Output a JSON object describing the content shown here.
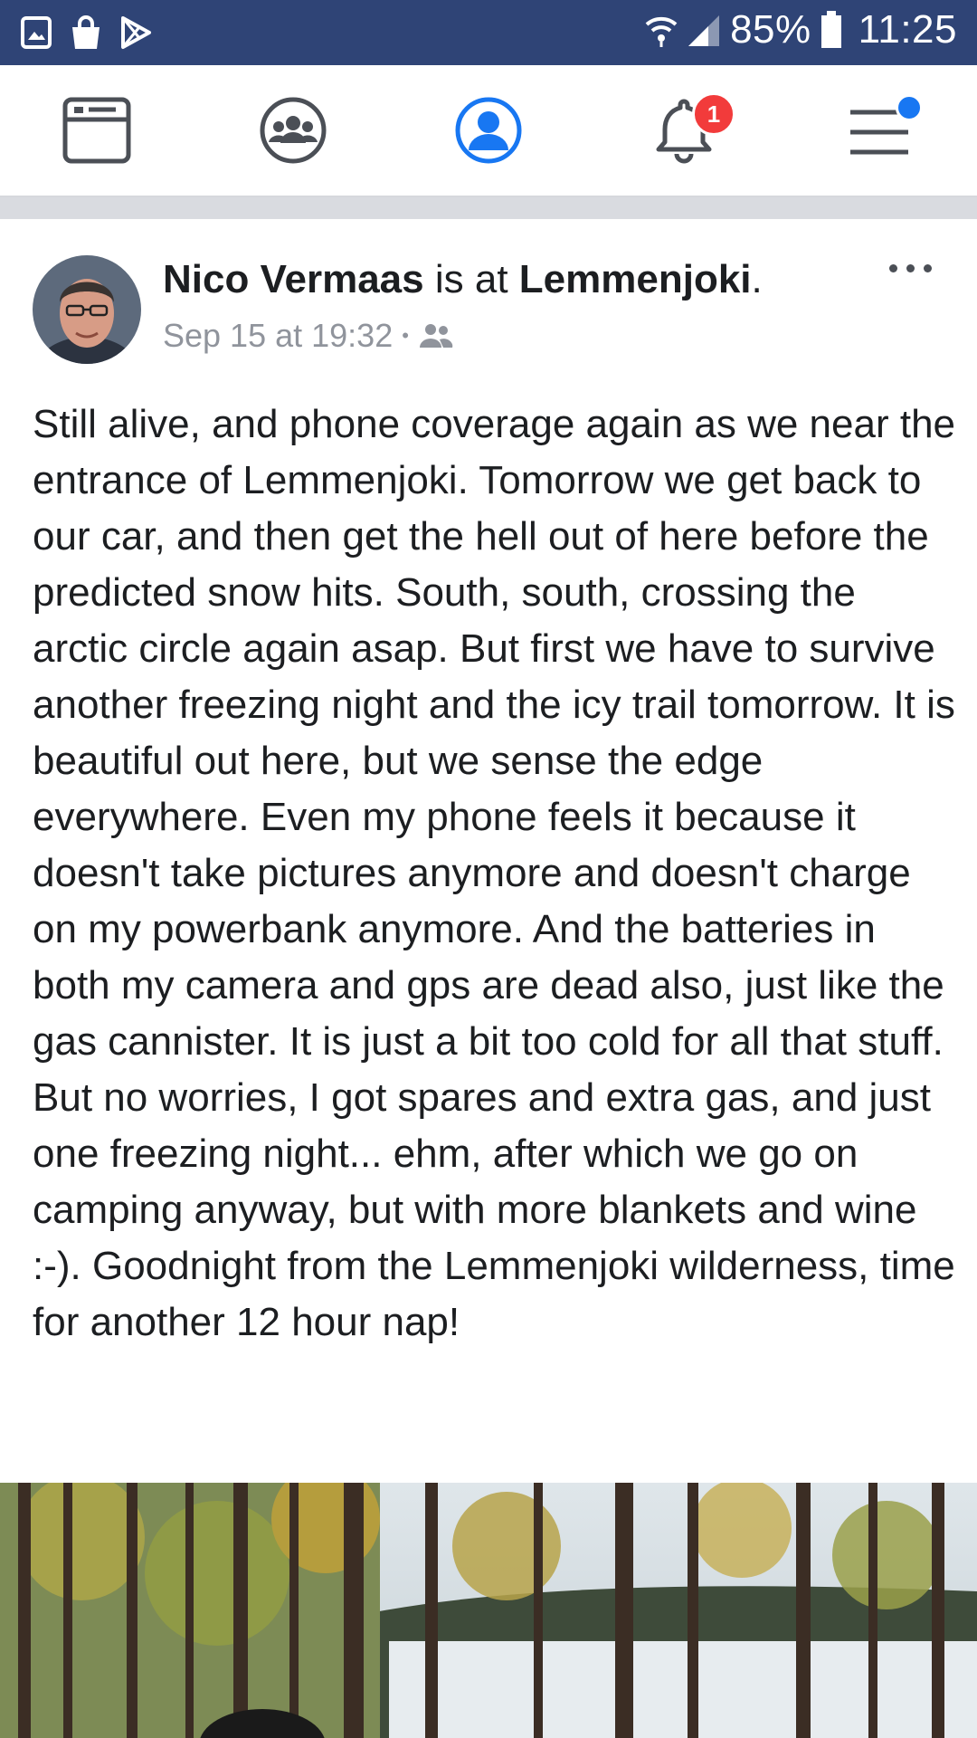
{
  "status_bar": {
    "battery_percent": "85%",
    "time": "11:25",
    "icons": [
      "gallery-icon",
      "shopping-bag-icon",
      "play-store-icon",
      "wifi-icon",
      "signal-icon",
      "battery-icon"
    ]
  },
  "nav": {
    "items": [
      {
        "name": "news-feed",
        "icon": "news-feed-icon"
      },
      {
        "name": "groups",
        "icon": "groups-icon"
      },
      {
        "name": "profile",
        "icon": "profile-icon",
        "active": true
      },
      {
        "name": "notifications",
        "icon": "bell-icon",
        "badge": "1"
      },
      {
        "name": "menu",
        "icon": "hamburger-icon",
        "dot": true
      }
    ],
    "accent": "#1877f2",
    "badge_color": "#f23b3b"
  },
  "post": {
    "author": "Nico Vermaas",
    "connector": "is at",
    "location": "Lemmenjoki",
    "period": ".",
    "timestamp": "Sep 15 at 19:32",
    "separator": "•",
    "audience_icon": "friends-icon",
    "body": "Still alive, and phone coverage again as we near the entrance of Lemmenjoki. Tomorrow we get back to our car, and then get the hell out of here before the predicted snow hits. South, south, crossing the arctic circle again asap. But first we have to survive another freezing night and the icy trail tomorrow. It is beautiful out here, but we sense the edge everywhere. Even my phone feels it because it doesn't take pictures anymore and doesn't charge on my powerbank anymore. And the batteries in both my camera and gps are dead also, just like the gas cannister. It is just a bit too cold for all that stuff. But no worries, I got spares and extra gas, and just one freezing night... ehm, after which we go on camping anyway, but with more blankets and wine :-). Goodnight from the Lemmenjoki wilderness, time for another 12 hour nap!"
  },
  "colors": {
    "status_bar": "#2f4476",
    "text": "#1c1e21",
    "meta": "#90949c"
  }
}
